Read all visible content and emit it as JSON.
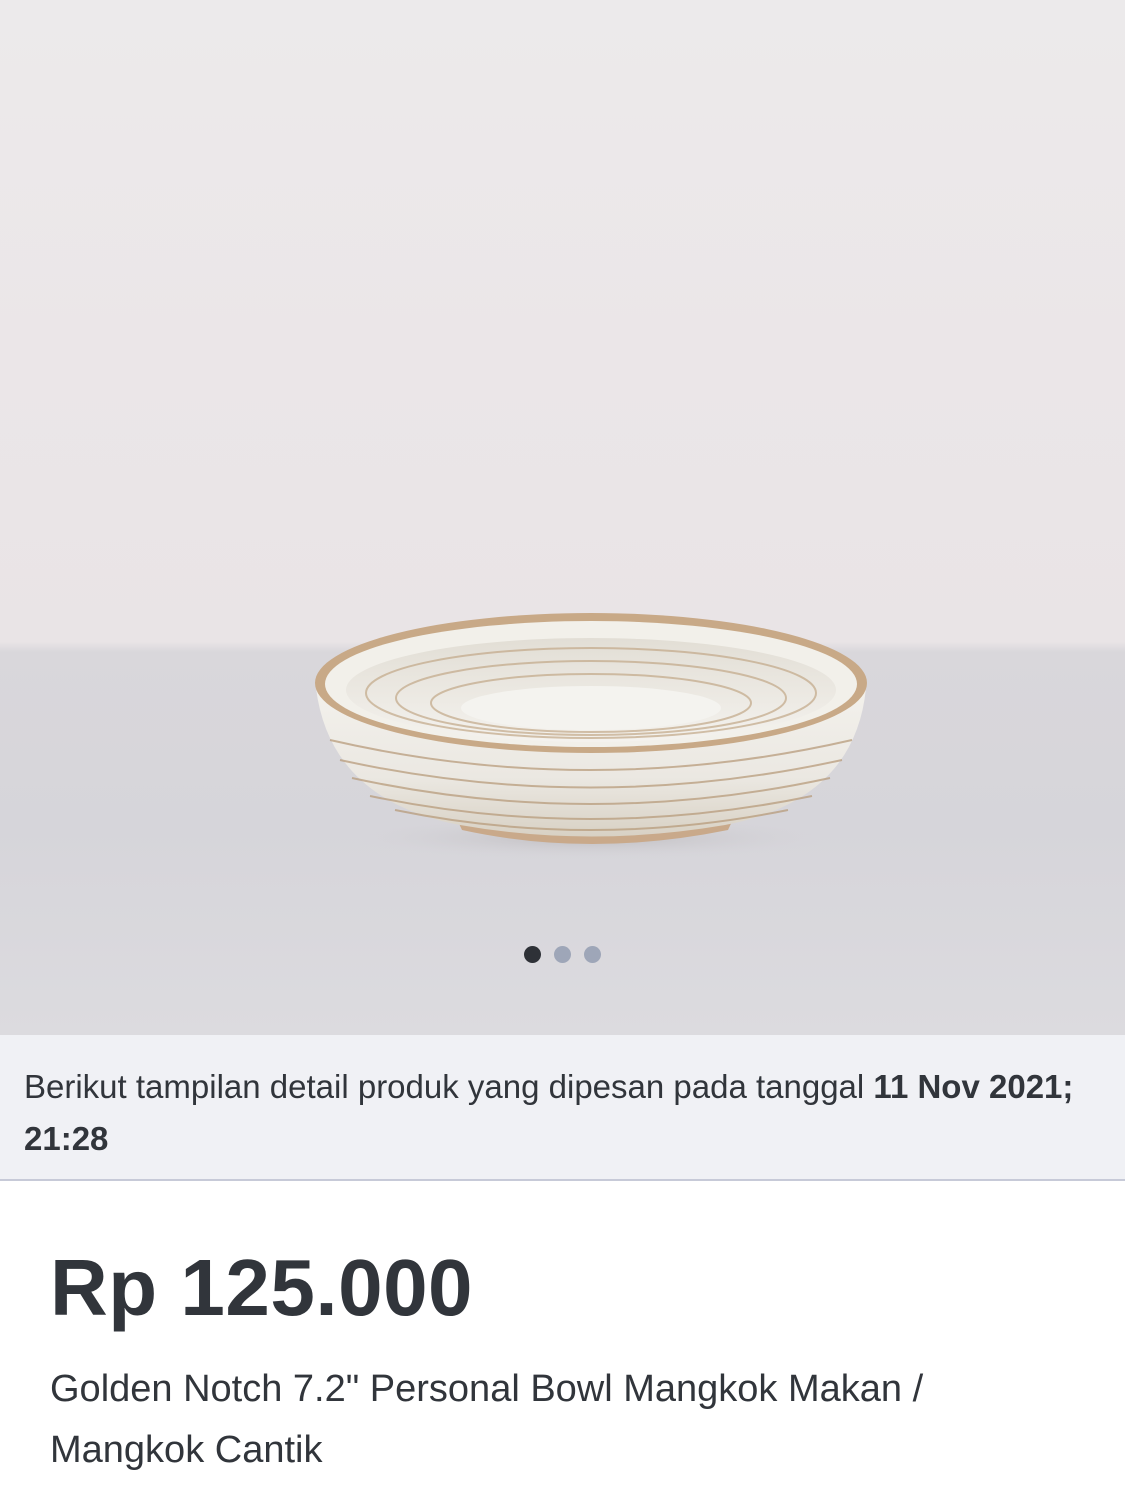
{
  "gallery": {
    "image_alt": "white ceramic bowl with golden notch rings",
    "dots": [
      {
        "active": true
      },
      {
        "active": false
      },
      {
        "active": false
      }
    ]
  },
  "order_info": {
    "text": "Berikut tampilan detail produk yang dipesan pada tanggal ",
    "date": "11 Nov 2021; 21:28"
  },
  "product": {
    "price": "Rp 125.000",
    "title": "Golden Notch 7.2\" Personal Bowl Mangkok Makan / Mangkok Cantik"
  },
  "colors": {
    "text": "#31353b",
    "info_bar_bg": "#f0f1f5",
    "dot_active": "#2e3137",
    "dot_inactive": "#9ea6b8"
  }
}
